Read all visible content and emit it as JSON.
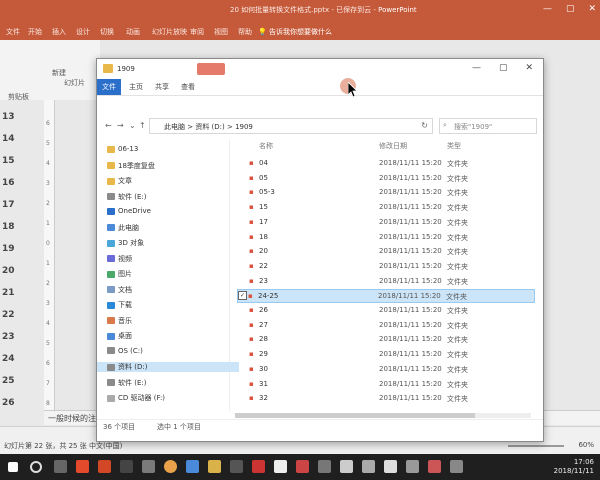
{
  "ppt": {
    "title": "20 如何批量转换文件格式.pptx - 已保存到云",
    "app": "PowerPoint",
    "tabs": [
      "文件",
      "开始",
      "插入",
      "设计",
      "切换",
      "动画",
      "幻灯片放映",
      "审阅",
      "视图",
      "帮助"
    ],
    "tell_me": "告诉我你想要做什么",
    "ribbon_labels": [
      "新建",
      "幻灯片",
      "剪贴板"
    ],
    "slide_numbers": [
      "13",
      "14",
      "15",
      "16",
      "17",
      "18",
      "19",
      "20",
      "21",
      "22",
      "23",
      "24",
      "25",
      "26"
    ],
    "slide_thumbs": [
      "",
      "",
      "",
      "",
      "",
      "",
      "",
      "",
      "",
      "",
      "",
      "",
      "",
      ""
    ],
    "ruler_marks": [
      "6",
      "5",
      "4",
      "3",
      "2",
      "1",
      "0",
      "1",
      "2",
      "3",
      "4",
      "5",
      "6",
      "7",
      "8",
      "9"
    ],
    "notes": "一般时候的注意",
    "status_left": "幻灯片第 22 张，共 25 张   中文(中国)",
    "zoom": "60%",
    "clock_time": "17:06",
    "clock_date": "2018/11/11"
  },
  "explorer": {
    "title": "1909",
    "tabs": [
      "文件",
      "主页",
      "共享",
      "查看"
    ],
    "address": "此电脑 > 资料 (D:) > 1909",
    "search_placeholder": "搜索\"1909\"",
    "nav": [
      {
        "label": "06-13",
        "icon": "folder-icon"
      },
      {
        "label": "18季度复盘",
        "icon": "folder-icon"
      },
      {
        "label": "文章",
        "icon": "folder-icon"
      },
      {
        "label": "软件 (E:)",
        "icon": "drive-icon"
      },
      {
        "label": "OneDrive",
        "icon": "cloud-icon"
      },
      {
        "label": "此电脑",
        "icon": "pc-icon"
      },
      {
        "label": "3D 对象",
        "icon": "cube-icon"
      },
      {
        "label": "视频",
        "icon": "video-icon"
      },
      {
        "label": "图片",
        "icon": "picture-icon"
      },
      {
        "label": "文档",
        "icon": "document-icon"
      },
      {
        "label": "下载",
        "icon": "download-icon"
      },
      {
        "label": "音乐",
        "icon": "music-icon"
      },
      {
        "label": "桌面",
        "icon": "desktop-icon"
      },
      {
        "label": "OS (C:)",
        "icon": "drive-icon"
      },
      {
        "label": "资料 (D:)",
        "icon": "drive-icon"
      },
      {
        "label": "软件 (E:)",
        "icon": "drive-icon"
      },
      {
        "label": "CD 驱动器 (F:)",
        "icon": "cd-icon"
      }
    ],
    "columns": {
      "name": "名称",
      "date": "修改日期",
      "type": "类型"
    },
    "files": [
      {
        "name": "04",
        "date": "2018/11/11 15:20",
        "type": "文件夹"
      },
      {
        "name": "05",
        "date": "2018/11/11 15:20",
        "type": "文件夹"
      },
      {
        "name": "05-3",
        "date": "2018/11/11 15:20",
        "type": "文件夹"
      },
      {
        "name": "15",
        "date": "2018/11/11 15:20",
        "type": "文件夹"
      },
      {
        "name": "17",
        "date": "2018/11/11 15:20",
        "type": "文件夹"
      },
      {
        "name": "18",
        "date": "2018/11/11 15:20",
        "type": "文件夹"
      },
      {
        "name": "20",
        "date": "2018/11/11 15:20",
        "type": "文件夹"
      },
      {
        "name": "22",
        "date": "2018/11/11 15:20",
        "type": "文件夹"
      },
      {
        "name": "23",
        "date": "2018/11/11 15:20",
        "type": "文件夹"
      },
      {
        "name": "24-25",
        "date": "2018/11/11 15:20",
        "type": "文件夹"
      },
      {
        "name": "26",
        "date": "2018/11/11 15:20",
        "type": "文件夹"
      },
      {
        "name": "27",
        "date": "2018/11/11 15:20",
        "type": "文件夹"
      },
      {
        "name": "28",
        "date": "2018/11/11 15:20",
        "type": "文件夹"
      },
      {
        "name": "29",
        "date": "2018/11/11 15:20",
        "type": "文件夹"
      },
      {
        "name": "30",
        "date": "2018/11/11 15:20",
        "type": "文件夹"
      },
      {
        "name": "31",
        "date": "2018/11/11 15:20",
        "type": "文件夹"
      },
      {
        "name": "32",
        "date": "2018/11/11 15:20",
        "type": "文件夹"
      }
    ],
    "selected_index": 9,
    "status_count": "36 个项目",
    "status_selected": "选中 1 个项目"
  },
  "colors": {
    "ppt_accent": "#c55a3a",
    "selection": "#cce4f7",
    "file_tab": "#2a6fc9"
  }
}
